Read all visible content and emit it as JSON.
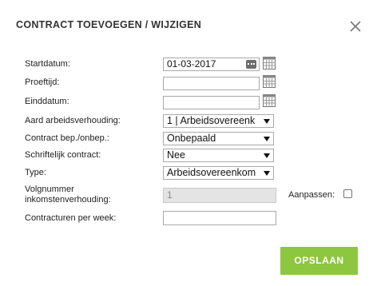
{
  "dialog": {
    "title": "CONTRACT TOEVOEGEN / WIJZIGEN",
    "close_icon": "close-icon"
  },
  "form": {
    "startdatum": {
      "label": "Startdatum:",
      "value": "01-03-2017"
    },
    "proeftijd": {
      "label": "Proeftijd:",
      "value": ""
    },
    "einddatum": {
      "label": "Einddatum:",
      "value": ""
    },
    "aard": {
      "label": "Aard arbeidsverhouding:",
      "value": "1 | Arbeidsovereenk"
    },
    "bepaald": {
      "label": "Contract bep./onbep.:",
      "value": "Onbepaald"
    },
    "schriftelijk": {
      "label": "Schriftelijk contract:",
      "value": "Nee"
    },
    "type": {
      "label": "Type:",
      "value": "Arbeidsovereenkom"
    },
    "volgnummer": {
      "label_line1": "Volgnummer",
      "label_line2": "inkomstenverhouding:",
      "value": "1"
    },
    "aanpassen": {
      "label": "Aanpassen:",
      "checked": false
    },
    "uren": {
      "label": "Contracturen per week:",
      "value": ""
    }
  },
  "footer": {
    "save_label": "OPSLAAN"
  },
  "colors": {
    "save_button": "#8dc63f",
    "disabled_field": "#e4e4e4"
  },
  "icons": {
    "calendar": "calendar-icon",
    "picker_dots": "ellipsis-icon"
  }
}
